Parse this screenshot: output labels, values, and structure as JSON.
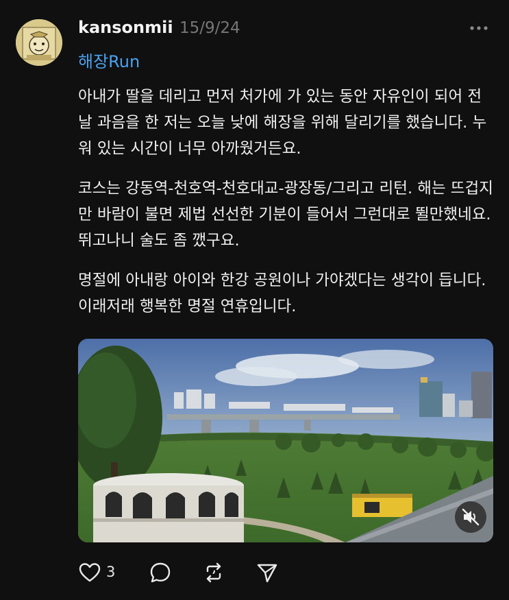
{
  "post": {
    "username": "kansonmii",
    "date": "15/9/24",
    "tag": "해장Run",
    "paragraphs": [
      "아내가 딸을 데리고 먼저 처가에 가 있는 동안 자유인이 되어 전날 과음을 한 저는 오늘 낮에 해장을 위해 달리기를 했습니다. 누워 있는 시간이 너무 아까웠거든요.",
      "코스는 강동역-천호역-천호대교-광장동/그리고 리턴. 해는 뜨겁지만 바람이 불면 제법 선선한 기분이 들어서 그런대로 뛸만했네요. 뛰고나니 술도 좀 깼구요.",
      "명절에 아내랑 아이와 한강 공원이나 가야겠다는 생각이 듭니다. 이래저래 행복한 명절 연휴입니다."
    ]
  },
  "actions": {
    "like_count": "3"
  },
  "icons": {
    "more": "more-horizontal-icon",
    "mute": "speaker-muted-icon",
    "like": "heart-icon",
    "comment": "comment-bubble-icon",
    "repost": "repost-icon",
    "share": "send-icon"
  },
  "colors": {
    "background": "#101010",
    "text": "#f3f3f3",
    "muted": "#777777",
    "link": "#4aa3f0"
  }
}
